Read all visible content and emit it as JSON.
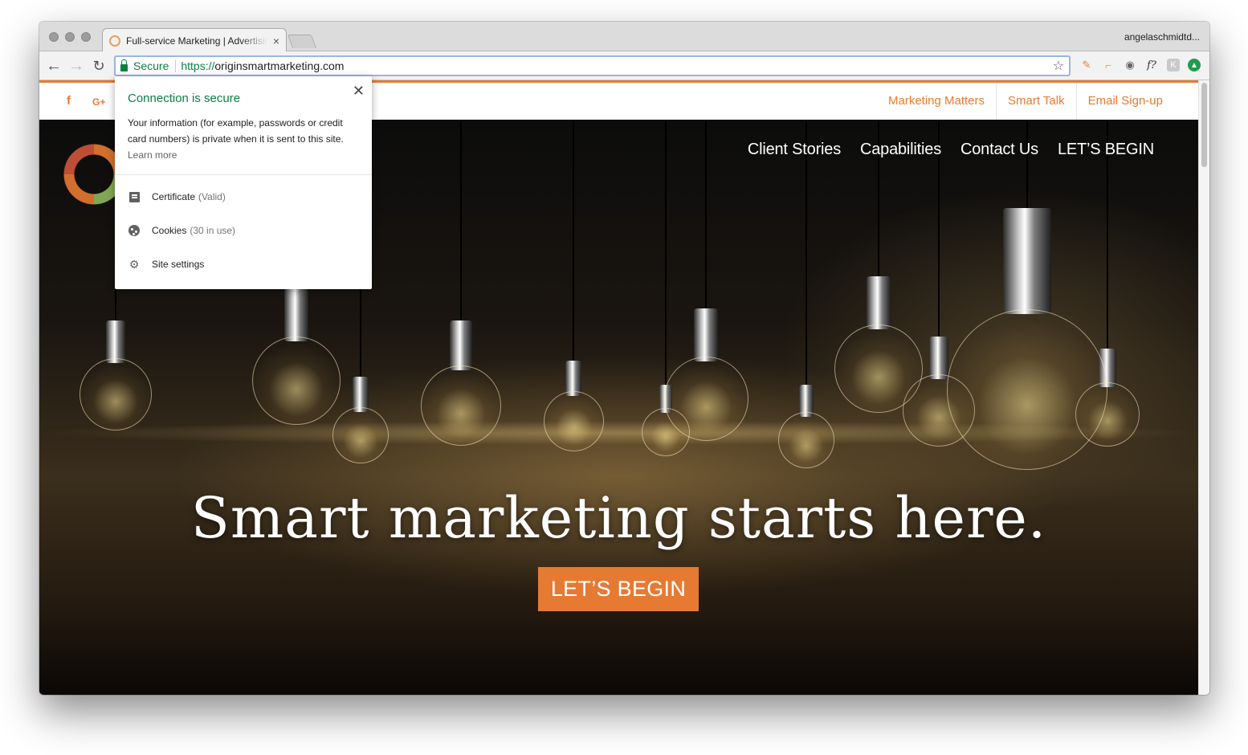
{
  "browser": {
    "tab_title": "Full-service Marketing | Advertising",
    "profile_name": "angelaschmidtd...",
    "secure_label": "Secure",
    "url_scheme": "https://",
    "url_host": "originsmartmarketing.com"
  },
  "popup": {
    "title": "Connection is secure",
    "body": "Your information (for example, passwords or credit card numbers) is private when it is sent to this site.",
    "learn_more": "Learn more",
    "certificate_label": "Certificate",
    "certificate_status": "(Valid)",
    "cookies_label": "Cookies",
    "cookies_status": "(30 in use)",
    "site_settings_label": "Site settings"
  },
  "topbar": {
    "social": [
      "f",
      "G+"
    ],
    "links": [
      "Marketing Matters",
      "Smart Talk",
      "Email Sign-up"
    ]
  },
  "nav": [
    "Client Stories",
    "Capabilities",
    "Contact Us",
    "LET’S BEGIN"
  ],
  "hero": {
    "headline": "Smart marketing starts here.",
    "cta": "LET’S BEGIN"
  },
  "colors": {
    "brand_orange": "#e77a32",
    "secure_green": "#0b8043"
  }
}
